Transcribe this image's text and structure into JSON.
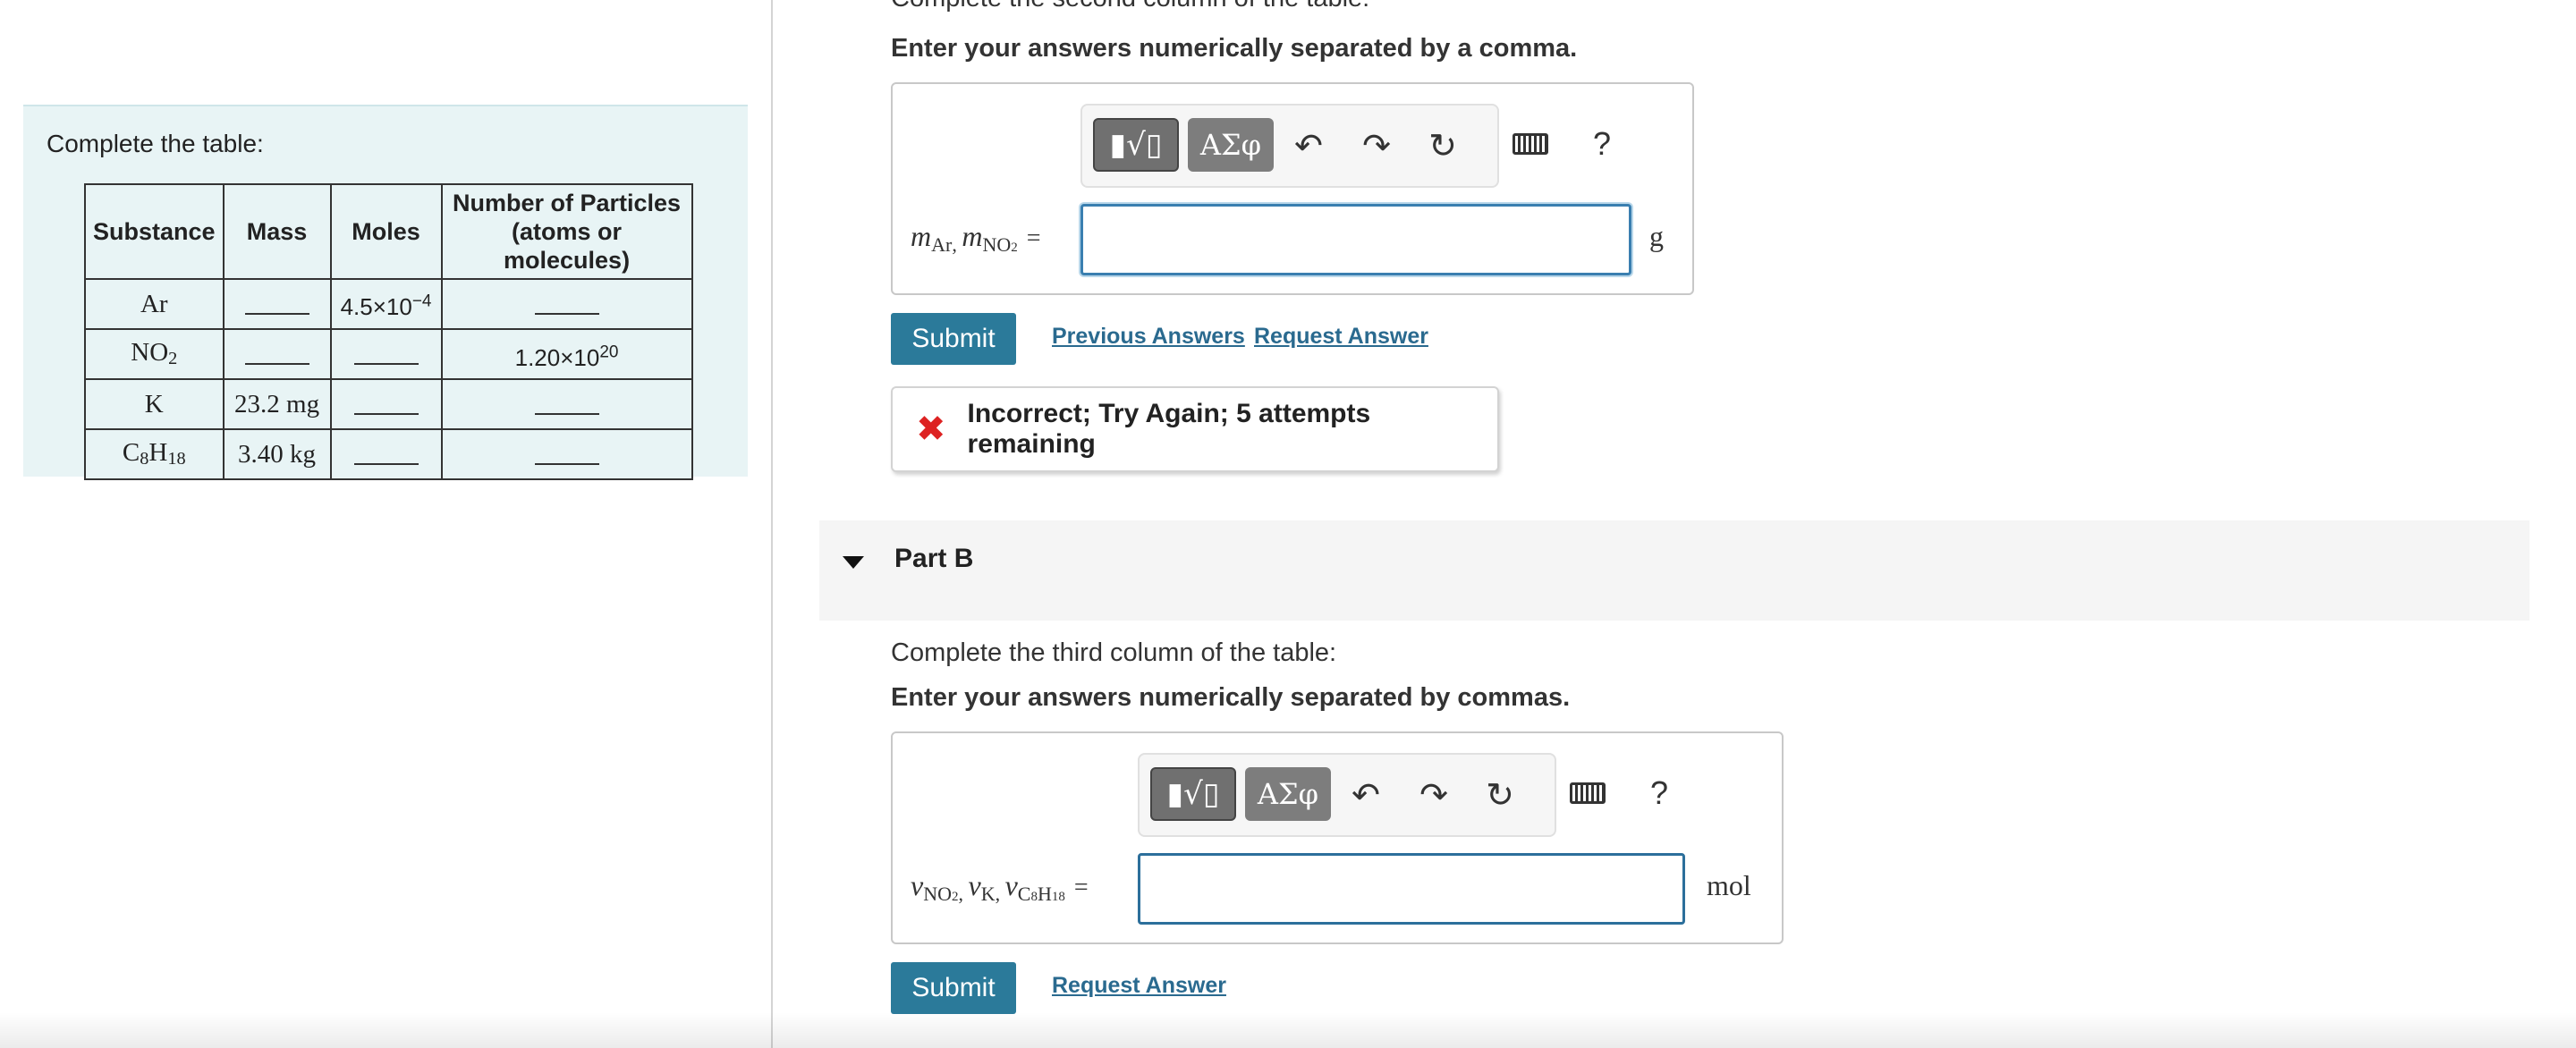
{
  "left": {
    "title": "Complete the table:",
    "table": {
      "headers": [
        "Substance",
        "Mass",
        "Moles",
        "Number of Particles",
        "(atoms or molecules)"
      ],
      "rows": [
        {
          "substance_base": "Ar",
          "substance_sub1": "",
          "substance_mid": "",
          "substance_sub2": "",
          "mass": "",
          "moles_base": "4.5×10",
          "moles_exp": "−4",
          "particles_base": "",
          "particles_exp": ""
        },
        {
          "substance_base": "NO",
          "substance_sub1": "2",
          "substance_mid": "",
          "substance_sub2": "",
          "mass": "",
          "moles_base": "",
          "moles_exp": "",
          "particles_base": "1.20×10",
          "particles_exp": "20"
        },
        {
          "substance_base": "K",
          "substance_sub1": "",
          "substance_mid": "",
          "substance_sub2": "",
          "mass": "23.2 mg",
          "moles_base": "",
          "moles_exp": "",
          "particles_base": "",
          "particles_exp": ""
        },
        {
          "substance_base": "C",
          "substance_sub1": "8",
          "substance_mid": "H",
          "substance_sub2": "18",
          "mass": "3.40 kg",
          "moles_base": "",
          "moles_exp": "",
          "particles_base": "",
          "particles_exp": ""
        }
      ]
    }
  },
  "partA": {
    "cut_prompt": "Complete the second column of the table:",
    "instruction": "Enter your answers numerically separated by a comma.",
    "toolbar": {
      "template_btn": "▮√▯",
      "symbols_btn": "ΑΣφ",
      "undo": "↶",
      "redo": "↷",
      "reset": "↻",
      "keyboard": "keyboard-icon",
      "help": "?"
    },
    "label": {
      "v1": "m",
      "s1": "Ar",
      "sep": ", ",
      "v2": "m",
      "s2": "NO",
      "s2sub": "2",
      "eq": "="
    },
    "input_value": "",
    "unit": "g",
    "submit": "Submit",
    "previous_answers": "Previous Answers",
    "request_answer": "Request Answer",
    "feedback": "Incorrect; Try Again; 5 attempts remaining"
  },
  "partB": {
    "title": "Part B",
    "prompt": "Complete the third column of the table:",
    "instruction": "Enter your answers numerically separated by commas.",
    "toolbar": {
      "template_btn": "▮√▯",
      "symbols_btn": "ΑΣφ",
      "undo": "↶",
      "redo": "↷",
      "reset": "↻",
      "keyboard": "keyboard-icon",
      "help": "?"
    },
    "label": {
      "v1": "ν",
      "s1": "NO",
      "s1sub": "2",
      "sep1": ", ",
      "v2": "ν",
      "s2": "K",
      "sep2": ", ",
      "v3": "ν",
      "s3a": "C",
      "s3b": "8",
      "s3c": "H",
      "s3d": "18",
      "eq": "="
    },
    "input_value": "",
    "unit": "mol",
    "submit": "Submit",
    "request_answer": "Request Answer"
  }
}
